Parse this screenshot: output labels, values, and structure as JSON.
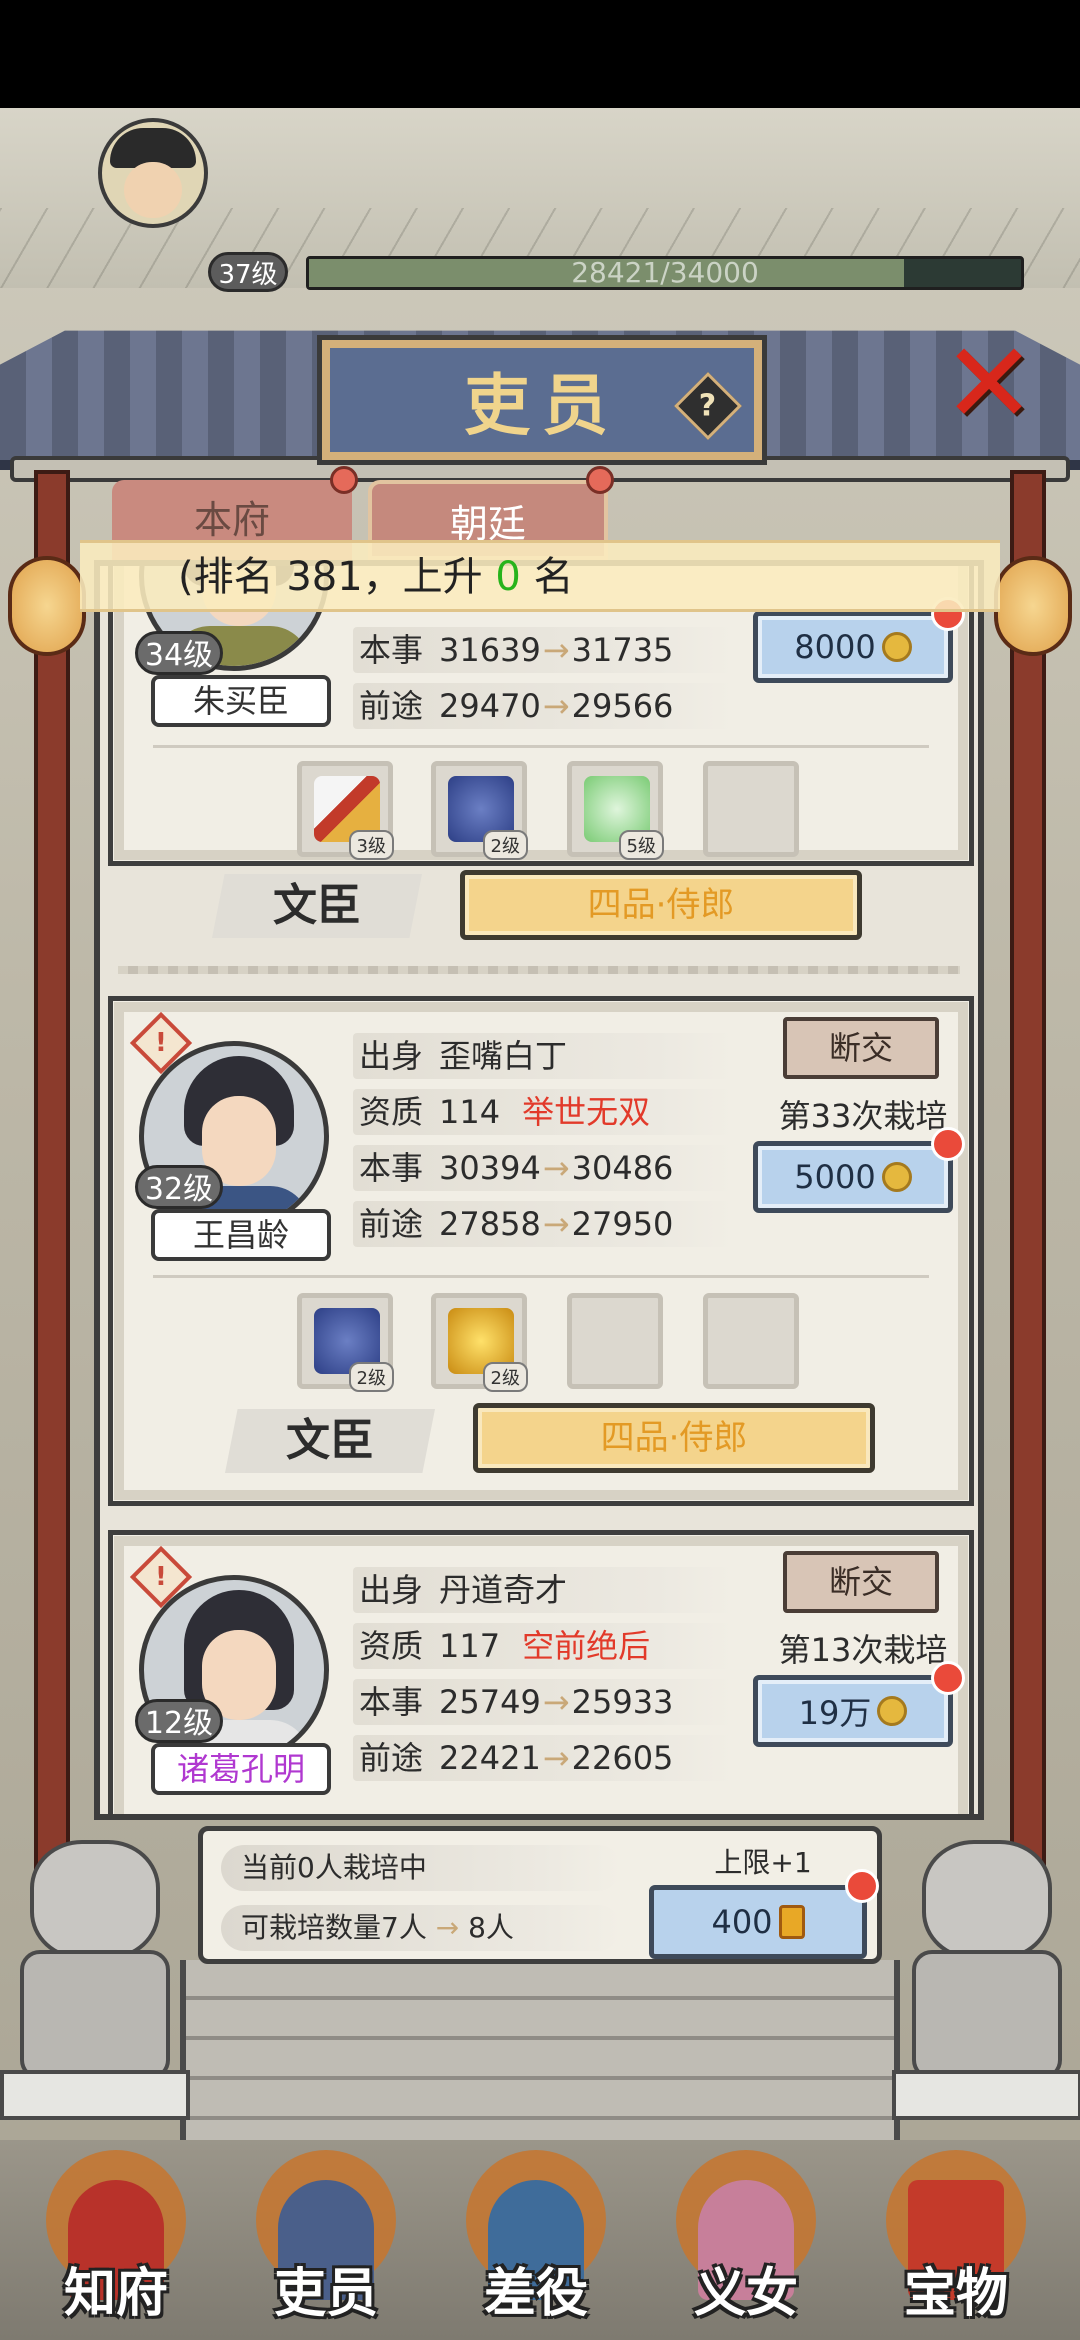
{
  "player": {
    "level": "37级",
    "exp_text": "28421/34000",
    "exp_fraction": 0.836
  },
  "header": {
    "title": "吏员",
    "help": "?"
  },
  "tabs": [
    {
      "label": "本府"
    },
    {
      "label": "朝廷"
    }
  ],
  "rank_banner": {
    "prefix": "(排名 381，上升",
    "rise": "0",
    "suffix": "名"
  },
  "clerks": [
    {
      "name": "朱买臣",
      "level": "34级",
      "stats": {
        "ability_label": "本事",
        "ability_from": "31639",
        "ability_to": "31735",
        "prospect_label": "前途",
        "prospect_from": "29470",
        "prospect_to": "29566"
      },
      "cost": "8000",
      "equipment": [
        {
          "icon": "sword-icon",
          "level": "3级"
        },
        {
          "icon": "robe-icon",
          "level": "2级"
        },
        {
          "icon": "jade-cabbage-icon",
          "level": "5级"
        }
      ],
      "role": "文臣",
      "rank": "四品·侍郎"
    },
    {
      "name": "王昌龄",
      "level": "32级",
      "stats": {
        "origin_label": "出身",
        "origin": "歪嘴白丁",
        "talent_label": "资质",
        "talent": "114",
        "talent_grade": "举世无双",
        "ability_label": "本事",
        "ability_from": "30394",
        "ability_to": "30486",
        "prospect_label": "前途",
        "prospect_from": "27858",
        "prospect_to": "27950"
      },
      "break_label": "断交",
      "train_count": "第33次栽培",
      "cost": "5000",
      "equipment": [
        {
          "icon": "robe-icon",
          "level": "2级"
        },
        {
          "icon": "golden-rooster-icon",
          "level": "2级"
        }
      ],
      "role": "文臣",
      "rank": "四品·侍郎"
    },
    {
      "name": "诸葛孔明",
      "level": "12级",
      "stats": {
        "origin_label": "出身",
        "origin": "丹道奇才",
        "talent_label": "资质",
        "talent": "117",
        "talent_grade": "空前绝后",
        "ability_label": "本事",
        "ability_from": "25749",
        "ability_to": "25933",
        "prospect_label": "前途",
        "prospect_from": "22421",
        "prospect_to": "22605"
      },
      "break_label": "断交",
      "train_count": "第13次栽培",
      "cost": "19万"
    }
  ],
  "summary": {
    "current": "当前0人栽培中",
    "capacity_prefix": "可栽培数量7人",
    "capacity_next": "8人",
    "limit_label": "上限+1",
    "limit_cost": "400"
  },
  "nav": [
    {
      "label": "知府"
    },
    {
      "label": "吏员"
    },
    {
      "label": "差役"
    },
    {
      "label": "义女"
    },
    {
      "label": "宝物"
    }
  ],
  "colors": {
    "accent_red": "#e23a2a",
    "rank_gold": "#e39a25",
    "rise_green": "#27b31b",
    "button_blue": "#b8d2ec"
  }
}
